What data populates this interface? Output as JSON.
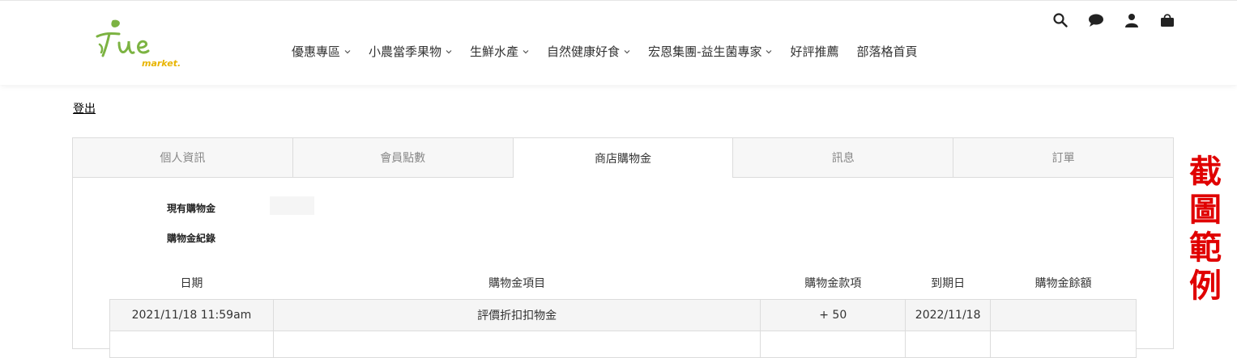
{
  "logo": {
    "main_text": "Tue",
    "sub_text": "market.",
    "colors": {
      "main": "#7cb342",
      "sub": "#e8b400"
    }
  },
  "nav": {
    "items": [
      {
        "label": "優惠專區",
        "has_dropdown": true
      },
      {
        "label": "小農當季果物",
        "has_dropdown": true
      },
      {
        "label": "生鮮水產",
        "has_dropdown": true
      },
      {
        "label": "自然健康好食",
        "has_dropdown": true
      },
      {
        "label": "宏恩集團-益生菌專家",
        "has_dropdown": true
      },
      {
        "label": "好評推薦",
        "has_dropdown": false
      },
      {
        "label": "部落格首頁",
        "has_dropdown": false
      }
    ]
  },
  "header_icons": [
    "search-icon",
    "chat-icon",
    "user-icon",
    "cart-icon"
  ],
  "account": {
    "logout_label": "登出",
    "tabs": [
      {
        "label": "個人資訊",
        "active": false
      },
      {
        "label": "會員點數",
        "active": false
      },
      {
        "label": "商店購物金",
        "active": true
      },
      {
        "label": "訊息",
        "active": false
      },
      {
        "label": "訂單",
        "active": false
      }
    ],
    "current_credit_label": "現有購物金",
    "credit_history_label": "購物金紀錄",
    "table": {
      "headers": [
        "日期",
        "購物金項目",
        "購物金款項",
        "到期日",
        "購物金餘額"
      ],
      "rows": [
        [
          "2021/11/18 11:59am",
          "評價折扣扣物金",
          "+ 50",
          "2022/11/18",
          ""
        ]
      ]
    }
  },
  "watermark": {
    "chars": [
      "截",
      "圖",
      "範",
      "例"
    ],
    "color": "#e00000"
  }
}
